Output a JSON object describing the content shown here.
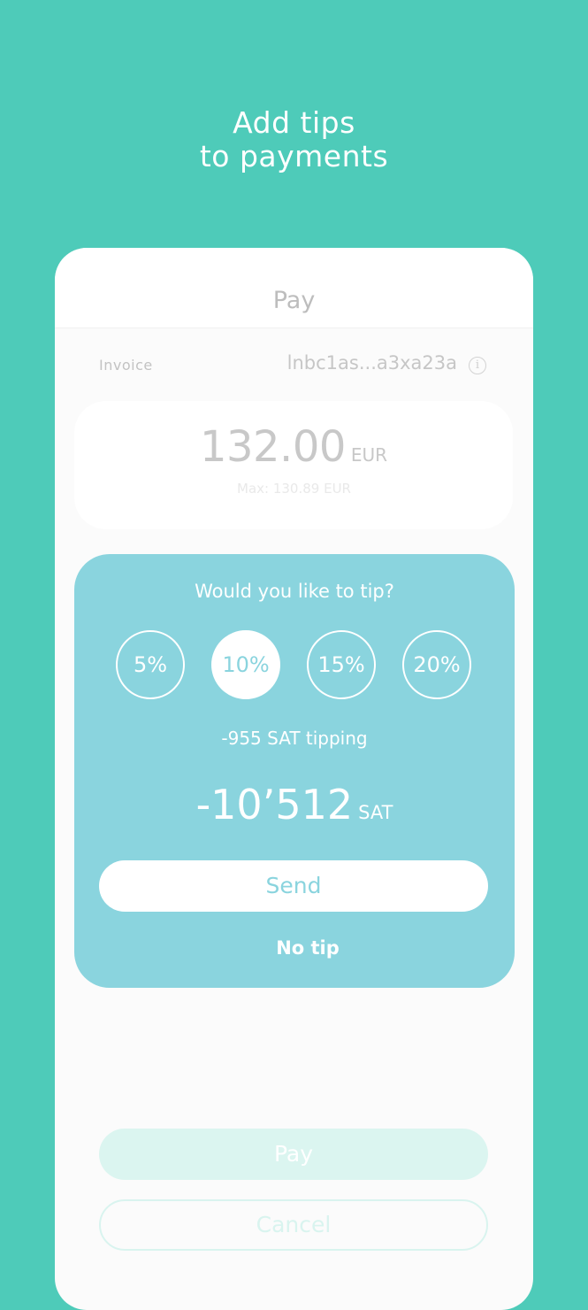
{
  "headline": {
    "line1": "Add tips",
    "line2": "to payments"
  },
  "header": {
    "title": "Pay"
  },
  "invoice": {
    "label": "Invoice",
    "value": "lnbc1as...a3xa23a",
    "info_icon": "info-icon",
    "info_glyph": "i"
  },
  "amount": {
    "value": "132.00",
    "currency": "EUR",
    "max_text": "Max: 130.89 EUR"
  },
  "tip": {
    "question": "Would you like to tip?",
    "options": [
      {
        "label": "5%",
        "selected": false
      },
      {
        "label": "10%",
        "selected": true
      },
      {
        "label": "15%",
        "selected": false
      },
      {
        "label": "20%",
        "selected": false
      }
    ],
    "tipping_text": "-955 SAT tipping",
    "total_value": "-10’512",
    "total_unit": "SAT",
    "send_label": "Send",
    "no_tip_label": "No tip"
  },
  "actions": {
    "pay_label": "Pay",
    "cancel_label": "Cancel"
  },
  "colors": {
    "background": "#4ecbb9",
    "tip_card": "#8ad4de",
    "pay_button": "#dbf5f0"
  }
}
